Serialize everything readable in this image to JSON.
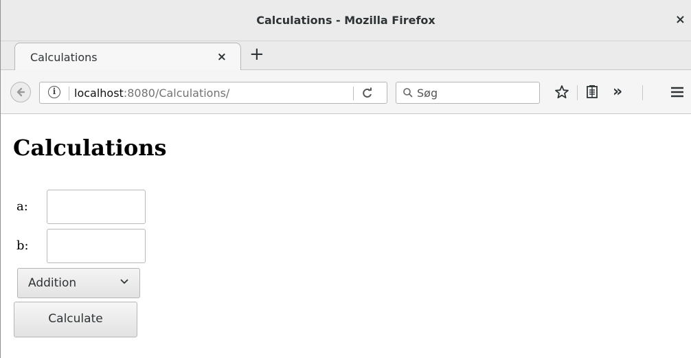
{
  "window": {
    "title": "Calculations - Mozilla Firefox",
    "close_glyph": "×"
  },
  "tabs": [
    {
      "label": "Calculations",
      "close_glyph": "×",
      "active": true
    }
  ],
  "new_tab_glyph": "+",
  "navbar": {
    "url_host": "localhost",
    "url_rest": ":8080/Calculations/",
    "search_placeholder": "Søg",
    "icons": [
      "back-arrow-icon",
      "info-icon",
      "reload-icon",
      "search-icon",
      "bookmark-star-icon",
      "reader-list-icon",
      "overflow-chevrons-icon",
      "hamburger-menu-icon"
    ]
  },
  "page": {
    "heading": "Calculations",
    "fields": [
      {
        "label": "a:",
        "value": ""
      },
      {
        "label": "b:",
        "value": ""
      }
    ],
    "operation": {
      "selected": "Addition"
    },
    "submit_label": "Calculate"
  }
}
